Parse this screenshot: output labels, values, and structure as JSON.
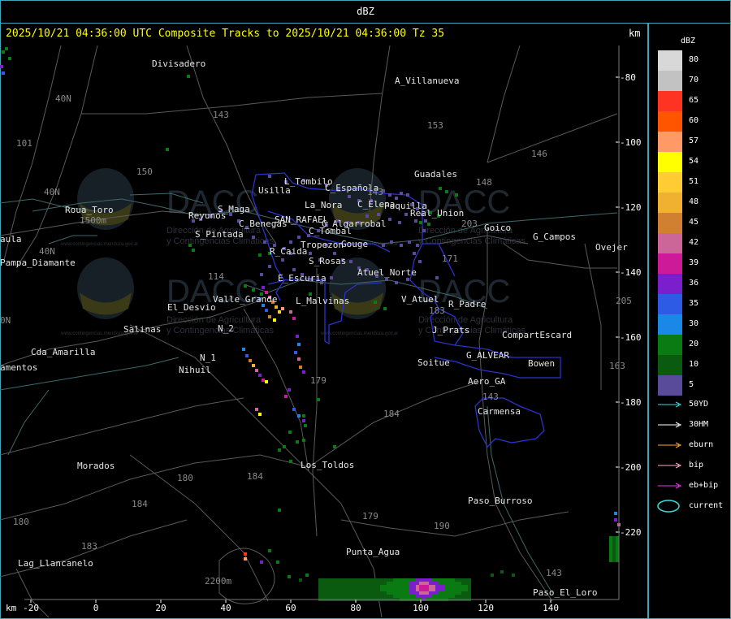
{
  "header": {
    "title": "dBZ",
    "subtitle": "2025/10/21 04:36:00 UTC Composite Tracks to 2025/10/21 04:36:00 Tz 35",
    "km_top": "km",
    "km_bottom": "km"
  },
  "axes": {
    "x_ticks": [
      "-20",
      "0",
      "20",
      "40",
      "60",
      "80",
      "100",
      "120",
      "140"
    ],
    "y_ticks": [
      "-80",
      "-100",
      "-120",
      "-140",
      "-160",
      "-180",
      "-200",
      "-220"
    ]
  },
  "legend": {
    "title": "dBZ",
    "levels": [
      {
        "label": "80",
        "color": "#d8d8d8"
      },
      {
        "label": "70",
        "color": "#c2c2c2"
      },
      {
        "label": "65",
        "color": "#ff3322"
      },
      {
        "label": "60",
        "color": "#ff5500"
      },
      {
        "label": "57",
        "color": "#ff9966"
      },
      {
        "label": "54",
        "color": "#ffff00"
      },
      {
        "label": "51",
        "color": "#ffcc33"
      },
      {
        "label": "48",
        "color": "#f0b030"
      },
      {
        "label": "45",
        "color": "#d08030"
      },
      {
        "label": "42",
        "color": "#cc6699"
      },
      {
        "label": "39",
        "color": "#cc1a99"
      },
      {
        "label": "36",
        "color": "#7b1fcc"
      },
      {
        "label": "35",
        "color": "#2e5be6"
      },
      {
        "label": "30",
        "color": "#1a88e6"
      },
      {
        "label": "20",
        "color": "#0a7a12"
      },
      {
        "label": "10",
        "color": "#0a5a10"
      },
      {
        "label": "5",
        "color": "#5a4a9a"
      }
    ],
    "tracks": [
      {
        "label": "50YD",
        "color": "#33dddd"
      },
      {
        "label": "30HM",
        "color": "#ffffff"
      },
      {
        "label": "eburn",
        "color": "#ffaa33"
      },
      {
        "label": "bip",
        "color": "#ffaacc"
      },
      {
        "label": "eb+bip",
        "color": "#ee33ee"
      },
      {
        "label": "current",
        "color": "#33dddd"
      }
    ]
  },
  "places": [
    "Divisadero",
    "A_Villanueva",
    "Guadales",
    "L_Tombilo",
    "C_Española",
    "C_Elena",
    "Paquilla",
    "Real_Union",
    "Usilla",
    "La_Nora",
    "Goico",
    "G_Campos",
    "Ovejer",
    "Roua_Toro",
    "1500m",
    "Reyunos",
    "S_Maga",
    "C_Benegas",
    "SAN_RAFAEL",
    "G_Algarrobal",
    "C_Tombal",
    "S_Pintada",
    "Tropezon",
    "Gouge",
    "R_Caida",
    "aula",
    "Pampa_Diamante",
    "S_Rosas",
    "Atuel_Norte",
    "E_Escuria",
    "Valle_Grande",
    "L_Malvinas",
    "V_Atuel",
    "R_Padre",
    "El_Desvio",
    "Salinas",
    "N_2",
    "J_Prats",
    "CompartEscard",
    "Cda_Amarilla",
    "N_1",
    "Nihuil",
    "G_ALVEAR",
    "Bowen",
    "Soitue",
    "amentos",
    "Aero_GA",
    "Carmensa",
    "Morados",
    "Los_Toldos",
    "Paso_Burroso",
    "Lag_Llancanelo",
    "Punta_Agua",
    "2200m",
    "Paso_El_Loro",
    "40N",
    "40N",
    "40N",
    "0N"
  ],
  "route_numbers": [
    "101",
    "143",
    "153",
    "146",
    "150",
    "148",
    "143",
    "203",
    "171",
    "114",
    "183",
    "205",
    "163",
    "179",
    "184",
    "184",
    "180",
    "184",
    "183",
    "179",
    "190",
    "143",
    "180",
    "143"
  ],
  "watermark": {
    "brand": "DACC",
    "line1": "Dirección de Agricultura",
    "line2": "y Contingencias Climáticas",
    "url": "www.contingencias.mendoza.gov.ar"
  }
}
